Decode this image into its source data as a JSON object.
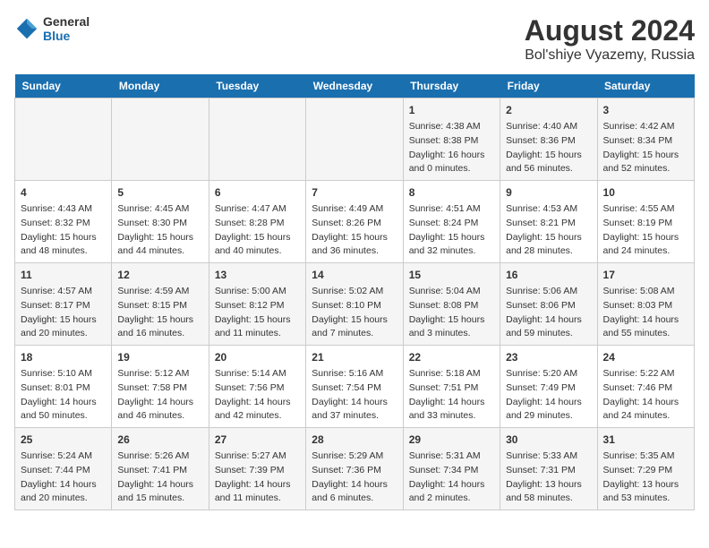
{
  "logo": {
    "line1": "General",
    "line2": "Blue"
  },
  "title": "August 2024",
  "subtitle": "Bol'shiye Vyazemy, Russia",
  "days_of_week": [
    "Sunday",
    "Monday",
    "Tuesday",
    "Wednesday",
    "Thursday",
    "Friday",
    "Saturday"
  ],
  "weeks": [
    [
      {
        "day": "",
        "info": ""
      },
      {
        "day": "",
        "info": ""
      },
      {
        "day": "",
        "info": ""
      },
      {
        "day": "",
        "info": ""
      },
      {
        "day": "1",
        "info": "Sunrise: 4:38 AM\nSunset: 8:38 PM\nDaylight: 16 hours\nand 0 minutes."
      },
      {
        "day": "2",
        "info": "Sunrise: 4:40 AM\nSunset: 8:36 PM\nDaylight: 15 hours\nand 56 minutes."
      },
      {
        "day": "3",
        "info": "Sunrise: 4:42 AM\nSunset: 8:34 PM\nDaylight: 15 hours\nand 52 minutes."
      }
    ],
    [
      {
        "day": "4",
        "info": "Sunrise: 4:43 AM\nSunset: 8:32 PM\nDaylight: 15 hours\nand 48 minutes."
      },
      {
        "day": "5",
        "info": "Sunrise: 4:45 AM\nSunset: 8:30 PM\nDaylight: 15 hours\nand 44 minutes."
      },
      {
        "day": "6",
        "info": "Sunrise: 4:47 AM\nSunset: 8:28 PM\nDaylight: 15 hours\nand 40 minutes."
      },
      {
        "day": "7",
        "info": "Sunrise: 4:49 AM\nSunset: 8:26 PM\nDaylight: 15 hours\nand 36 minutes."
      },
      {
        "day": "8",
        "info": "Sunrise: 4:51 AM\nSunset: 8:24 PM\nDaylight: 15 hours\nand 32 minutes."
      },
      {
        "day": "9",
        "info": "Sunrise: 4:53 AM\nSunset: 8:21 PM\nDaylight: 15 hours\nand 28 minutes."
      },
      {
        "day": "10",
        "info": "Sunrise: 4:55 AM\nSunset: 8:19 PM\nDaylight: 15 hours\nand 24 minutes."
      }
    ],
    [
      {
        "day": "11",
        "info": "Sunrise: 4:57 AM\nSunset: 8:17 PM\nDaylight: 15 hours\nand 20 minutes."
      },
      {
        "day": "12",
        "info": "Sunrise: 4:59 AM\nSunset: 8:15 PM\nDaylight: 15 hours\nand 16 minutes."
      },
      {
        "day": "13",
        "info": "Sunrise: 5:00 AM\nSunset: 8:12 PM\nDaylight: 15 hours\nand 11 minutes."
      },
      {
        "day": "14",
        "info": "Sunrise: 5:02 AM\nSunset: 8:10 PM\nDaylight: 15 hours\nand 7 minutes."
      },
      {
        "day": "15",
        "info": "Sunrise: 5:04 AM\nSunset: 8:08 PM\nDaylight: 15 hours\nand 3 minutes."
      },
      {
        "day": "16",
        "info": "Sunrise: 5:06 AM\nSunset: 8:06 PM\nDaylight: 14 hours\nand 59 minutes."
      },
      {
        "day": "17",
        "info": "Sunrise: 5:08 AM\nSunset: 8:03 PM\nDaylight: 14 hours\nand 55 minutes."
      }
    ],
    [
      {
        "day": "18",
        "info": "Sunrise: 5:10 AM\nSunset: 8:01 PM\nDaylight: 14 hours\nand 50 minutes."
      },
      {
        "day": "19",
        "info": "Sunrise: 5:12 AM\nSunset: 7:58 PM\nDaylight: 14 hours\nand 46 minutes."
      },
      {
        "day": "20",
        "info": "Sunrise: 5:14 AM\nSunset: 7:56 PM\nDaylight: 14 hours\nand 42 minutes."
      },
      {
        "day": "21",
        "info": "Sunrise: 5:16 AM\nSunset: 7:54 PM\nDaylight: 14 hours\nand 37 minutes."
      },
      {
        "day": "22",
        "info": "Sunrise: 5:18 AM\nSunset: 7:51 PM\nDaylight: 14 hours\nand 33 minutes."
      },
      {
        "day": "23",
        "info": "Sunrise: 5:20 AM\nSunset: 7:49 PM\nDaylight: 14 hours\nand 29 minutes."
      },
      {
        "day": "24",
        "info": "Sunrise: 5:22 AM\nSunset: 7:46 PM\nDaylight: 14 hours\nand 24 minutes."
      }
    ],
    [
      {
        "day": "25",
        "info": "Sunrise: 5:24 AM\nSunset: 7:44 PM\nDaylight: 14 hours\nand 20 minutes."
      },
      {
        "day": "26",
        "info": "Sunrise: 5:26 AM\nSunset: 7:41 PM\nDaylight: 14 hours\nand 15 minutes."
      },
      {
        "day": "27",
        "info": "Sunrise: 5:27 AM\nSunset: 7:39 PM\nDaylight: 14 hours\nand 11 minutes."
      },
      {
        "day": "28",
        "info": "Sunrise: 5:29 AM\nSunset: 7:36 PM\nDaylight: 14 hours\nand 6 minutes."
      },
      {
        "day": "29",
        "info": "Sunrise: 5:31 AM\nSunset: 7:34 PM\nDaylight: 14 hours\nand 2 minutes."
      },
      {
        "day": "30",
        "info": "Sunrise: 5:33 AM\nSunset: 7:31 PM\nDaylight: 13 hours\nand 58 minutes."
      },
      {
        "day": "31",
        "info": "Sunrise: 5:35 AM\nSunset: 7:29 PM\nDaylight: 13 hours\nand 53 minutes."
      }
    ]
  ]
}
